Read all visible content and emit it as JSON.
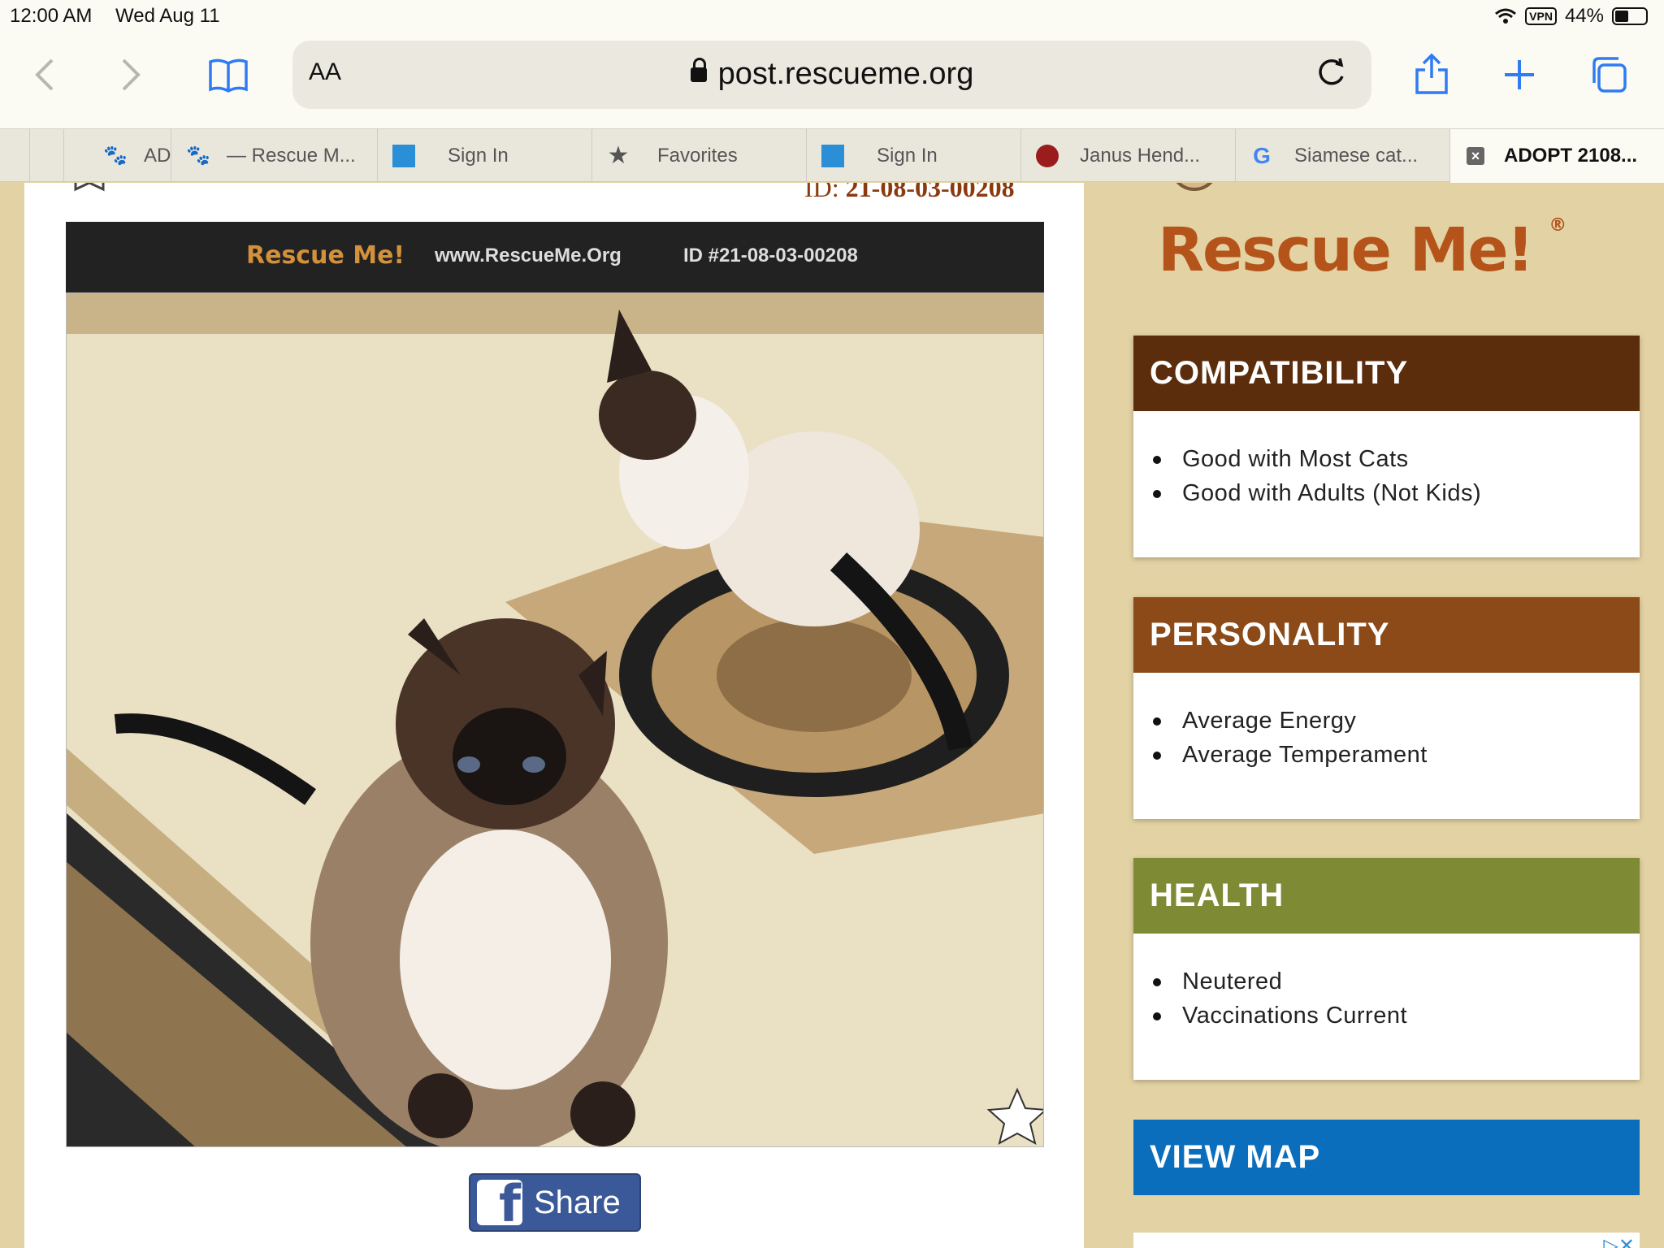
{
  "status": {
    "time": "12:00 AM",
    "date": "Wed Aug 11",
    "vpn": "VPN",
    "battery": "44%",
    "battery_level": 0.44
  },
  "toolbar": {
    "text_size": "AA",
    "url": "post.rescueme.org"
  },
  "tabs": [
    {
      "label": "",
      "icon": "paw-icon"
    },
    {
      "label": "AD",
      "icon": "paw-icon"
    },
    {
      "label": "— Rescue M...",
      "icon": "paw-icon"
    },
    {
      "label": "Sign In",
      "icon": "bank-icon"
    },
    {
      "label": "Favorites",
      "icon": "star-icon"
    },
    {
      "label": "Sign In",
      "icon": "bank-icon"
    },
    {
      "label": "Janus Hend...",
      "icon": "globe-icon"
    },
    {
      "label": "Siamese cat...",
      "icon": "google-icon"
    },
    {
      "label": "ADOPT 2108...",
      "icon": "close-icon"
    }
  ],
  "pet": {
    "id_prefix": "ID:",
    "id_value": "21-08-03-00208",
    "banner_logo": "Rescue Me!",
    "banner_site": "www.RescueMe.Org",
    "banner_id": "ID #21-08-03-00208",
    "share_label": "Share"
  },
  "sidebar": {
    "brand": "Rescue Me!",
    "registered": "®",
    "compatibility": {
      "title": "COMPATIBILITY",
      "color": "#5c2d0c",
      "items": [
        "Good with Most Cats",
        "Good with Adults (Not Kids)"
      ]
    },
    "personality": {
      "title": "PERSONALITY",
      "color": "#8b4a17",
      "items": [
        "Average Energy",
        "Average Temperament"
      ]
    },
    "health": {
      "title": "HEALTH",
      "color": "#7f8a34",
      "items": [
        "Neutered",
        "Vaccinations Current"
      ]
    },
    "view_map": "VIEW MAP",
    "view_map_color": "#0a6ebd"
  }
}
